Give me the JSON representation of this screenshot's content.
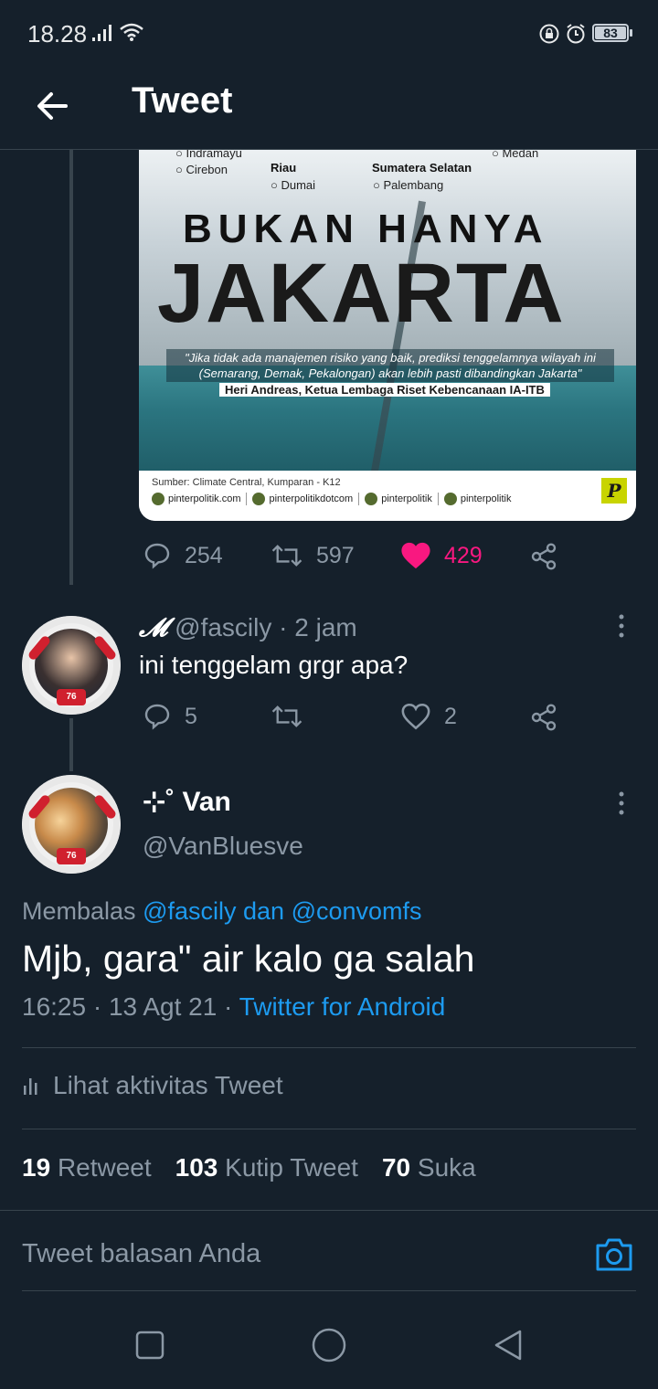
{
  "status_bar": {
    "time": "18.28",
    "battery": "83"
  },
  "header": {
    "title": "Tweet"
  },
  "embedded_image": {
    "cities": {
      "indramayu": "Indramayu",
      "cirebon": "Cirebon",
      "riau": "Riau",
      "dumai": "Dumai",
      "sumatera_selatan": "Sumatera Selatan",
      "palembang": "Palembang",
      "medan": "Medan"
    },
    "headline_top": "BUKAN HANYA",
    "headline_main": "JAKARTA",
    "quote": "\"Jika tidak ada manajemen risiko yang baik, prediksi tenggelamnya wilayah ini (Semarang, Demak, Pekalongan) akan lebih pasti dibandingkan Jakarta\"",
    "quote_author": "Heri Andreas, Ketua Lembaga Riset Kebencanaan IA-ITB",
    "source": "Sumber: Climate Central, Kumparan - K12",
    "socials": [
      "pinterpolitik.com",
      "pinterpolitikdotcom",
      "pinterpolitik",
      "pinterpolitik"
    ],
    "logo": "P"
  },
  "original_tweet_actions": {
    "replies": "254",
    "retweets": "597",
    "likes": "429"
  },
  "reply_tweet": {
    "display_name_glyph": "𝓜",
    "handle": "@fascily",
    "time": "· 2 jam",
    "text": "ini tenggelam grgr apa?",
    "replies": "5",
    "likes": "2",
    "avatar_badge": "76"
  },
  "main_tweet": {
    "display_name": "⊹˚ Van",
    "handle": "@VanBluesve",
    "replying_prefix": "Membalas",
    "replying_to_1": "@fascily",
    "replying_and": "dan",
    "replying_to_2": "@convomfs",
    "text": "Mjb, gara\" air kalo ga salah",
    "timestamp": "16:25 · 13 Agt 21 ·",
    "client": "Twitter for Android",
    "avatar_badge": "76"
  },
  "activity": {
    "label": "Lihat aktivitas Tweet"
  },
  "stats": {
    "retweets_count": "19",
    "retweets_label": "Retweet",
    "quotes_count": "103",
    "quotes_label": "Kutip Tweet",
    "likes_count": "70",
    "likes_label": "Suka"
  },
  "reply_composer": {
    "placeholder": "Tweet balasan Anda"
  },
  "colors": {
    "background": "#15202b",
    "accent": "#1d9bf0",
    "like": "#f91880",
    "muted": "#8b98a5"
  }
}
